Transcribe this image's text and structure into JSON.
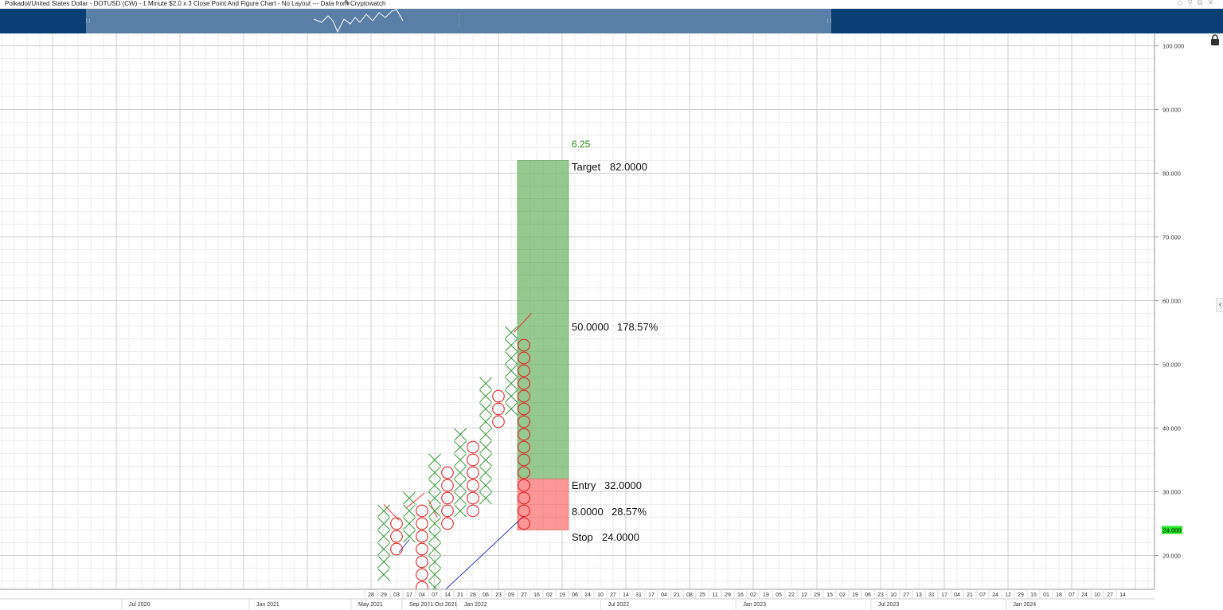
{
  "header": {
    "title": "Polkadot/United States Dollar - DOTUSD (CW) - 1 Minute $2.0 x 3 Close Point And Figure Chart - No Layout --- Data from Cryptowatch"
  },
  "icons": {
    "edit": "pencil-icon",
    "lock": "lock-icon",
    "collapse": "chevron-left-icon",
    "window_controls": [
      "diamond-icon",
      "pin-icon",
      "restore-icon",
      "close-icon"
    ]
  },
  "chart_data": {
    "type": "point_and_figure",
    "box_size": 2.0,
    "reversal": 3,
    "y_range": [
      14,
      104
    ],
    "y_ticks": [
      20,
      30,
      40,
      50,
      60,
      70,
      80,
      90,
      100
    ],
    "y_tick_labels": [
      "20.000",
      "30.000",
      "40.000",
      "50.000",
      "60.000",
      "70.000",
      "80.000",
      "90.000",
      "100.000"
    ],
    "current_price": 24.0,
    "current_price_label": "24.000",
    "columns": [
      {
        "type": "X",
        "low": 17,
        "high": 27
      },
      {
        "type": "O",
        "low": 21,
        "high": 25
      },
      {
        "type": "X",
        "low": 23,
        "high": 29
      },
      {
        "type": "O",
        "low": 15,
        "high": 27
      },
      {
        "type": "X",
        "low": 15,
        "high": 35
      },
      {
        "type": "O",
        "low": 25,
        "high": 33
      },
      {
        "type": "X",
        "low": 27,
        "high": 39
      },
      {
        "type": "O",
        "low": 27,
        "high": 37
      },
      {
        "type": "X",
        "low": 29,
        "high": 47
      },
      {
        "type": "O",
        "low": 41,
        "high": 45
      },
      {
        "type": "X",
        "low": 43,
        "high": 55
      },
      {
        "type": "O",
        "low": 25,
        "high": 53
      }
    ],
    "trendlines": [
      {
        "color": "#e23b3b",
        "points": [
          [
            0,
            28
          ],
          [
            1.2,
            25.5
          ]
        ]
      },
      {
        "color": "#e23b3b",
        "points": [
          [
            1.8,
            27.5
          ],
          [
            3.2,
            29.8
          ]
        ]
      },
      {
        "color": "#e23b3b",
        "points": [
          [
            3.5,
            28.8
          ],
          [
            4.2,
            26
          ]
        ]
      },
      {
        "color": "#e23b3b",
        "points": [
          [
            10.2,
            55
          ],
          [
            11.6,
            58
          ]
        ]
      },
      {
        "color": "#2b3bb8",
        "points": [
          [
            1.2,
            20.5
          ],
          [
            2.0,
            22.5
          ]
        ]
      },
      {
        "color": "#2b3bb8",
        "points": [
          [
            4.6,
            14.2
          ],
          [
            11.0,
            26.2
          ]
        ]
      }
    ],
    "position": {
      "target": 82.0,
      "entry": 32.0,
      "stop": 24.0,
      "ratio_label": "6.25",
      "target_label": "Target",
      "target_value": "82.0000",
      "reward_value": "50.0000",
      "reward_pct": "178.57%",
      "entry_label": "Entry",
      "entry_value": "32.0000",
      "risk_value": "8.0000",
      "risk_pct": "28.57%",
      "stop_label": "Stop",
      "stop_value": "24.0000"
    },
    "x_day_labels": [
      "28",
      "29",
      "03",
      "17",
      "04",
      "07",
      "14",
      "21",
      "28",
      "06",
      "23",
      "09",
      "27",
      "16",
      "02",
      "19",
      "06",
      "24",
      "10",
      "27",
      "14",
      "31",
      "17",
      "04",
      "21",
      "08",
      "25",
      "11",
      "29",
      "16",
      "02",
      "19",
      "05",
      "22",
      "12",
      "29",
      "15",
      "02",
      "19",
      "06",
      "23",
      "10",
      "27",
      "13",
      "31",
      "17",
      "04",
      "21",
      "07",
      "24",
      "12",
      "29",
      "15",
      "01",
      "18",
      "07",
      "24",
      "10",
      "27",
      "14"
    ],
    "x_month_labels": [
      {
        "text": "Jul 2020",
        "slot": -19
      },
      {
        "text": "Jan 2021",
        "slot": -9
      },
      {
        "text": "May 2021",
        "slot": -1
      },
      {
        "text": "Sep 2021",
        "slot": 3
      },
      {
        "text": "Oct 2021",
        "slot": 5
      },
      {
        "text": "Jan 2022",
        "slot": 7.3
      },
      {
        "text": "Jul 2022",
        "slot": 18.6
      },
      {
        "text": "Jan 2023",
        "slot": 29.2
      },
      {
        "text": "Jul 2023",
        "slot": 39.8
      },
      {
        "text": "Jan 2024",
        "slot": 50.4
      }
    ]
  }
}
